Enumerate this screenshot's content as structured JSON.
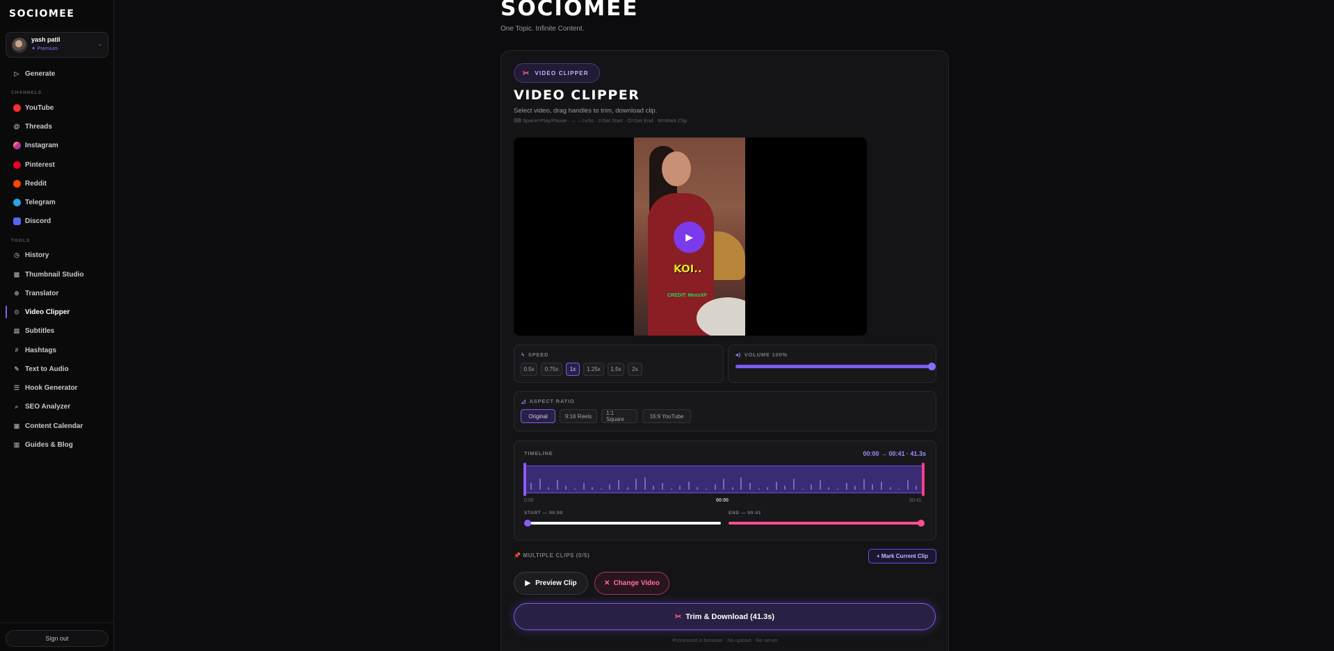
{
  "sidebar": {
    "logo": "SOCIOMEE",
    "user": {
      "name": "yash patil",
      "plan": "✦ Premium"
    },
    "generate_label": "Generate",
    "channels_label": "CHANNELS",
    "channels": [
      {
        "label": "YouTube",
        "color": "#ff2d2d"
      },
      {
        "label": "Threads",
        "icon": "threads-icon"
      },
      {
        "label": "Instagram",
        "color": "#e4408a"
      },
      {
        "label": "Pinterest",
        "color": "#e60023"
      },
      {
        "label": "Reddit",
        "color": "#ff4500"
      },
      {
        "label": "Telegram",
        "color": "#2aa3df"
      },
      {
        "label": "Discord",
        "color": "#5865f2"
      }
    ],
    "tools_label": "TOOLS",
    "tools": [
      {
        "label": "History"
      },
      {
        "label": "Thumbnail Studio"
      },
      {
        "label": "Translator"
      },
      {
        "label": "Video Clipper",
        "active": true
      },
      {
        "label": "Subtitles"
      },
      {
        "label": "Hashtags"
      },
      {
        "label": "Text to Audio"
      },
      {
        "label": "Hook Generator"
      },
      {
        "label": "SEO Analyzer"
      },
      {
        "label": "Content Calendar"
      },
      {
        "label": "Guides & Blog"
      }
    ],
    "signout_label": "Sign out"
  },
  "header": {
    "brand": "SOCIOMEE",
    "tagline": "One Topic. Infinite Content."
  },
  "clipper": {
    "pill_label": "VIDEO CLIPPER",
    "title": "VIDEO CLIPPER",
    "subtitle": "Select video, drag handles to trim, download clip.",
    "shortcuts": "⌨ Space=Play/Pause · ←→=±5s · I=Set Start · O=Set End · M=Mark Clip",
    "video": {
      "caption": "KOI..",
      "credit": "CREDIT: MensXP"
    },
    "speed": {
      "label": "SPEED",
      "options": [
        "0.5x",
        "0.75x",
        "1x",
        "1.25x",
        "1.5x",
        "2x"
      ],
      "selected": "1x"
    },
    "volume": {
      "label": "VOLUME 100%",
      "value": 1.0
    },
    "aspect": {
      "label": "ASPECT RATIO",
      "options": [
        "Original",
        "9:16 Reels",
        "1:1 Square",
        "16:9 YouTube"
      ],
      "selected": "Original"
    },
    "timeline": {
      "label": "TIMELINE",
      "range": "00:00 → 00:41 · 41.3s",
      "start_time": "0:00",
      "current_time": "00:00",
      "end_time": "00:41",
      "start_label": "START — 00:00",
      "end_label": "END — 00:41"
    },
    "multiple_clips_label": "MULTIPLE CLIPS (0/5)",
    "mark_clip_label": "+ Mark Current Clip",
    "preview_label": "Preview Clip",
    "change_label": "Change Video",
    "download_label": "Trim & Download (41.3s)",
    "footnote": "Processed in browser · No upload · No server"
  },
  "colors": {
    "accent": "#7c5cf0",
    "pink": "#ff4f95",
    "background": "#0c0c0e"
  }
}
